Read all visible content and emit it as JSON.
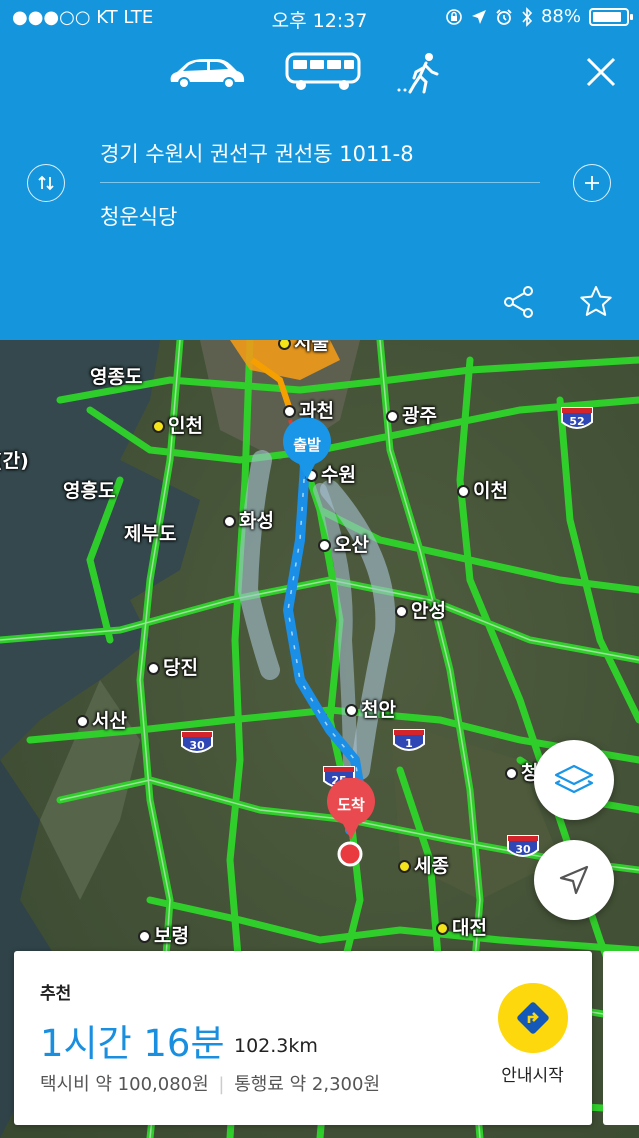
{
  "status_bar": {
    "carrier": "●●●○○ KT   LTE",
    "time": "오후 12:37",
    "battery": "88%",
    "battery_level": 0.88
  },
  "modes": [
    {
      "name": "car",
      "icon": "car-icon",
      "selected": true
    },
    {
      "name": "bus",
      "icon": "bus-icon",
      "selected": false
    },
    {
      "name": "walk",
      "icon": "walk-icon",
      "selected": false
    }
  ],
  "route": {
    "origin": "경기 수원시 권선구 권선동 1011-8",
    "destination": "청운식당"
  },
  "map": {
    "places": [
      {
        "name": "영종도"
      },
      {
        "name": "인천"
      },
      {
        "name": "과천"
      },
      {
        "name": "광주"
      },
      {
        "name": "영흥도"
      },
      {
        "name": "수원"
      },
      {
        "name": "이천"
      },
      {
        "name": "제부도"
      },
      {
        "name": "화성"
      },
      {
        "name": "오산"
      },
      {
        "name": "안성"
      },
      {
        "name": "당진"
      },
      {
        "name": "서산"
      },
      {
        "name": "천안"
      },
      {
        "name": "세종"
      },
      {
        "name": "대전"
      },
      {
        "name": "보령"
      },
      {
        "name": "청"
      }
    ],
    "partial_labels": {
      "seoul": "서울",
      "gan": "(간)"
    },
    "highways": [
      "52",
      "30",
      "1",
      "25",
      "30"
    ],
    "start_label": "출발",
    "end_label": "도착"
  },
  "result": {
    "tag": "추천",
    "duration": "1시간 16분",
    "distance": "102.3km",
    "taxi": "택시비 약 100,080원",
    "toll": "통행료 약 2,300원",
    "start_nav": "안내시작"
  },
  "colors": {
    "header": "#1596dc",
    "route": "#1b8ee6",
    "start_pin": "#1a96e8",
    "end_pin": "#e84a4f",
    "go_button": "#fcd80c"
  }
}
